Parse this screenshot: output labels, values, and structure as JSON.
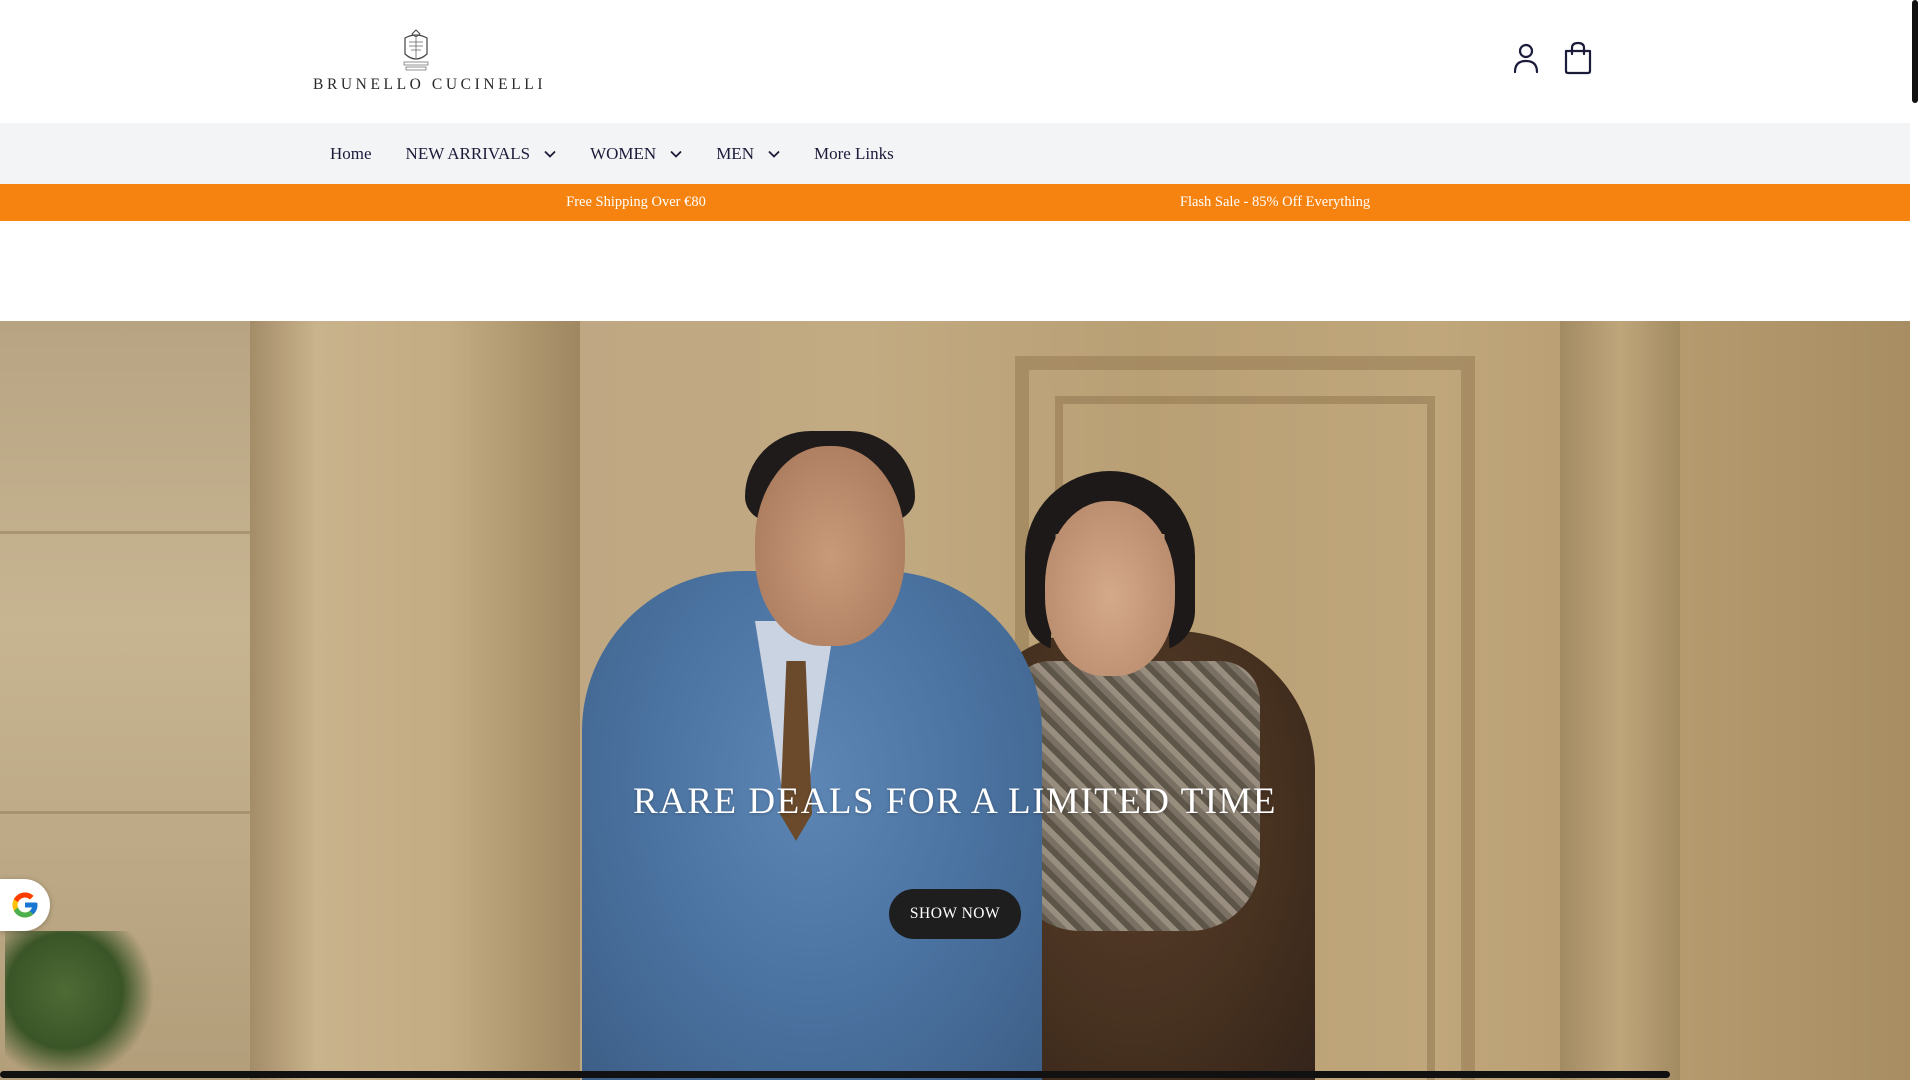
{
  "brand": {
    "name": "BRUNELLO CUCINELLI",
    "logo_icon": "crest-icon"
  },
  "header": {
    "account_icon": "user-icon",
    "cart_icon": "shopping-bag-icon"
  },
  "nav": {
    "items": [
      {
        "label": "Home",
        "has_dropdown": false
      },
      {
        "label": "NEW ARRIVALS",
        "has_dropdown": true
      },
      {
        "label": "WOMEN",
        "has_dropdown": true
      },
      {
        "label": "MEN",
        "has_dropdown": true
      },
      {
        "label": "More Links",
        "has_dropdown": false
      }
    ]
  },
  "announcements": [
    "Free Shipping Over €80",
    "Flash Sale - 85% Off Everything"
  ],
  "hero": {
    "title": "RARE DEALS FOR A LIMITED TIME",
    "button_label": "SHOW NOW"
  },
  "widgets": {
    "google_badge_icon": "google-icon"
  },
  "colors": {
    "announcement_bg": "#f6830f",
    "nav_bg": "#f3f4f6",
    "text": "#1b1b3a",
    "button_bg": "#1e1e1e"
  }
}
